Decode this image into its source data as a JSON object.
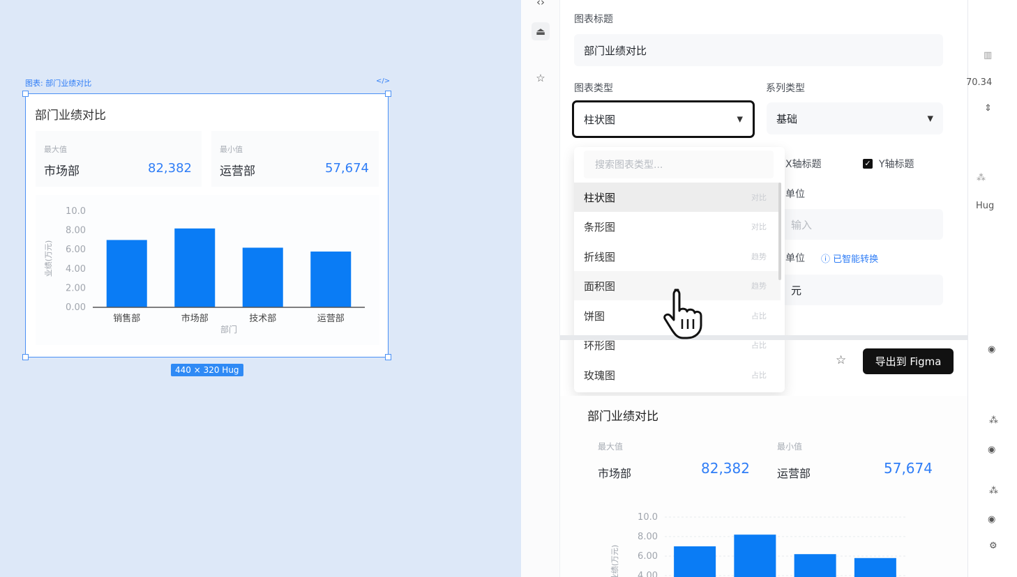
{
  "canvas": {
    "frame_label": "图表: 部门业绩对比",
    "size_tag": "440 × 320 Hug",
    "card": {
      "title": "部门业绩对比",
      "stats": [
        {
          "key": "最大值",
          "name": "市场部",
          "value": "82,382"
        },
        {
          "key": "最小值",
          "name": "运营部",
          "value": "57,674"
        }
      ]
    }
  },
  "panel": {
    "chart_title_label": "图表标题",
    "chart_title_value": "部门业绩对比",
    "chart_type_label": "图表类型",
    "chart_type_value": "柱状图",
    "series_type_label": "系列类型",
    "series_type_value": "基础",
    "x_axis_title": "X轴标题",
    "y_axis_title": "Y轴标题",
    "y_axis_checked": true,
    "unit_label_1": "单位",
    "unit_input_placeholder": "输入",
    "unit_label_2": "单位",
    "smart_convert": "已智能转换",
    "unit_value": "元",
    "export_label": "导出到 Figma",
    "dropdown": {
      "search_placeholder": "搜索图表类型...",
      "items": [
        {
          "label": "柱状图",
          "tag": "对比"
        },
        {
          "label": "条形图",
          "tag": "对比"
        },
        {
          "label": "折线图",
          "tag": "趋势"
        },
        {
          "label": "面积图",
          "tag": "趋势"
        },
        {
          "label": "饼图",
          "tag": "占比"
        },
        {
          "label": "环形图",
          "tag": "占比"
        },
        {
          "label": "玫瑰图",
          "tag": "占比"
        }
      ]
    },
    "preview": {
      "title": "部门业绩对比",
      "stats": [
        {
          "key": "最大值",
          "name": "市场部",
          "value": "82,382"
        },
        {
          "key": "最小值",
          "name": "运营部",
          "value": "57,674"
        }
      ]
    }
  },
  "strip": {
    "zoom": "70.34",
    "hug": "Hug"
  },
  "colors": {
    "bar": "#0a7cf5",
    "accent": "#2f7df6",
    "export_bg": "#111111"
  },
  "chart_data": [
    {
      "type": "bar",
      "categories": [
        "销售部",
        "市场部",
        "技术部",
        "运营部"
      ],
      "values": [
        7.0,
        8.2,
        6.2,
        5.8
      ],
      "xlabel": "部门",
      "ylabel": "业绩(万元)",
      "yticks": [
        "0.00",
        "2.00",
        "4.00",
        "6.00",
        "8.00",
        "10.0"
      ],
      "ylim": [
        0,
        10
      ]
    },
    {
      "type": "bar",
      "categories": [
        "销售部",
        "市场部",
        "技术部",
        "运营部"
      ],
      "values": [
        7.0,
        8.2,
        6.2,
        5.8
      ],
      "ylabel": "业绩(万元)",
      "yticks": [
        "4.00",
        "6.00",
        "8.00",
        "10.0"
      ],
      "ylim": [
        0,
        10
      ]
    }
  ]
}
